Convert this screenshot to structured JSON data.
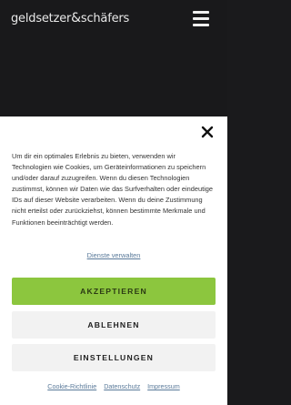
{
  "header": {
    "logo_part1": "geldsetzer",
    "logo_amp": "&",
    "logo_part2": "schäfers",
    "menu_icon": "hamburger-menu-icon"
  },
  "consent": {
    "close_icon": "close-icon",
    "message": "Um dir ein optimales Erlebnis zu bieten, verwenden wir Technologien wie Cookies, um Geräteinformationen zu speichern und/oder darauf zuzugreifen. Wenn du diesen Technologien zustimmst, können wir Daten wie das Surfverhalten oder eindeutige IDs auf dieser Website verarbeiten. Wenn du deine Zustimmung nicht erteilst oder zurückziehst, können bestimmte Merkmale und Funktionen beeinträchtigt werden.",
    "services_link": "Dienste verwalten",
    "accept_label": "AKZEPTIEREN",
    "deny_label": "ABLEHNEN",
    "settings_label": "EINSTELLUNGEN",
    "footer_links": {
      "cookie_policy": "Cookie-Richtlinie",
      "privacy": "Datenschutz",
      "imprint": "Impressum"
    }
  },
  "colors": {
    "accept": "#8cc63e",
    "background_dark": "#19191b",
    "link": "#5a7a9a"
  }
}
